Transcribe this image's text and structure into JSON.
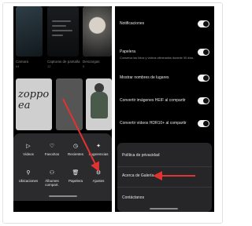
{
  "colors": {
    "accent_arrow": "#e23232",
    "panel_bg": "#000000",
    "sheet_bg": "#2b2b2d"
  },
  "gallery": {
    "albums": [
      {
        "name": "Camara",
        "count": "64"
      },
      {
        "name": "Capturas de pantalla",
        "count": "12"
      },
      {
        "name": "Descargas",
        "count": "5"
      }
    ],
    "tile_script_text": "zoppo ea"
  },
  "menu": {
    "items": [
      {
        "label": "Videos",
        "icon": "video-icon"
      },
      {
        "label": "Favoritos",
        "icon": "heart-icon"
      },
      {
        "label": "Recientes",
        "icon": "clock-icon"
      },
      {
        "label": "Sugerencias",
        "icon": "sparkle-icon"
      },
      {
        "label": "Ubicaciones",
        "icon": "location-pin-icon"
      },
      {
        "label": "Álbumes compart.",
        "icon": "shared-albums-icon"
      },
      {
        "label": "Papelera",
        "icon": "trash-icon"
      },
      {
        "label": "Ajustes",
        "icon": "gear-icon"
      }
    ]
  },
  "settings": {
    "rows": [
      {
        "label": "Notificaciones",
        "sub": "",
        "toggle_on": true
      },
      {
        "label": "Papelera",
        "sub": "Conserva las fotos y vídeos eliminados durante 30 días.",
        "toggle_on": true
      },
      {
        "label": "Mostrar nombres de lugares",
        "sub": "",
        "toggle_on": true
      },
      {
        "label": "Convertir imágenes HEIF al compartir",
        "sub": "",
        "toggle_on": true
      },
      {
        "label": "Convertir vídeos HDR10+ al compartir",
        "sub": "",
        "toggle_on": true
      }
    ],
    "links": [
      {
        "label": "Política de privacidad"
      },
      {
        "label": "Acerca de Galería"
      },
      {
        "label": "Contáctanos"
      }
    ]
  }
}
